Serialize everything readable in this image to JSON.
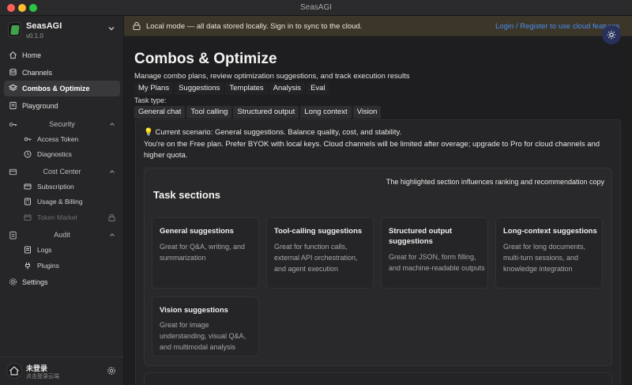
{
  "window": {
    "title": "SeasAGI"
  },
  "brand": {
    "name": "SeasAGI",
    "version": "v0.1.0"
  },
  "sidebar": {
    "items": [
      {
        "label": "Home",
        "icon": "home-icon"
      },
      {
        "label": "Channels",
        "icon": "database-icon"
      },
      {
        "label": "Combos & Optimize",
        "icon": "layers-icon"
      },
      {
        "label": "Playground",
        "icon": "document-icon"
      }
    ],
    "groups": {
      "security": {
        "label": "Security",
        "items": [
          "Access Token",
          "Diagnostics"
        ]
      },
      "cost": {
        "label": "Cost Center",
        "items": [
          "Subscription",
          "Usage & Billing",
          "Token Market"
        ]
      },
      "audit": {
        "label": "Audit",
        "items": [
          "Logs",
          "Plugins"
        ]
      }
    },
    "settings": "Settings",
    "user": {
      "name": "未登录",
      "sub": "点击登录云端"
    }
  },
  "banner": {
    "text": "Local mode — all data stored locally. Sign in to sync to the cloud.",
    "link": "Login / Register to use cloud features"
  },
  "page": {
    "title": "Combos & Optimize",
    "subtitle": "Manage combo plans, review optimization suggestions, and track execution results",
    "tabs": [
      "My Plans",
      "Suggestions",
      "Templates",
      "Analysis",
      "Eval"
    ],
    "task_type_label": "Task type:",
    "task_types": [
      "General chat",
      "Tool calling",
      "Structured output",
      "Long context",
      "Vision"
    ]
  },
  "panel": {
    "scenario": "💡 Current scenario: General suggestions. Balance quality, cost, and stability.",
    "plan_note": "You're on the Free plan. Prefer BYOK with local keys. Cloud channels will be limited after overage; upgrade to Pro for cloud channels and higher quota.",
    "sections_title": "Task sections",
    "sections_note": "The highlighted section influences ranking and recommendation copy",
    "cards": [
      {
        "title": "General suggestions",
        "desc": "Great for Q&A, writing, and summarization"
      },
      {
        "title": "Tool-calling suggestions",
        "desc": "Great for function calls, external API orchestration, and agent execution"
      },
      {
        "title": "Structured output suggestions",
        "desc": "Great for JSON, form filling, and machine-readable outputs"
      },
      {
        "title": "Long-context suggestions",
        "desc": "Great for long documents, multi-turn sessions, and knowledge integration"
      },
      {
        "title": "Vision suggestions",
        "desc": "Great for image understanding, visual Q&A, and multimodal analysis"
      }
    ]
  },
  "colors": {
    "accent_link": "#4b8df0",
    "banner_bg": "#3b3628",
    "theme_button": "#27315a"
  }
}
